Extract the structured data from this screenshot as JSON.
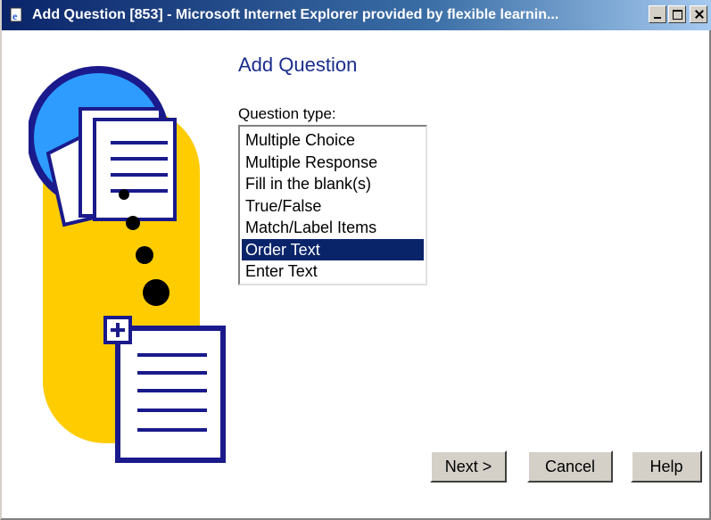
{
  "window": {
    "title": "Add Question [853] - Microsoft Internet Explorer provided by flexible learnin...",
    "icon": "ie-page-icon"
  },
  "dialog": {
    "heading": "Add Question",
    "question_type_label": "Question type:",
    "question_types": [
      "Multiple Choice",
      "Multiple Response",
      "Fill in the blank(s)",
      "True/False",
      "Match/Label Items",
      "Order Text",
      "Enter Text"
    ],
    "selected_type": "Order Text"
  },
  "buttons": {
    "next": "Next >",
    "cancel": "Cancel",
    "help": "Help"
  },
  "colors": {
    "heading": "#1a2c8c",
    "selection": "#0a246a",
    "art_yellow": "#ffcc00",
    "art_blue": "#2e9bff",
    "art_navy": "#1a1a8c"
  }
}
